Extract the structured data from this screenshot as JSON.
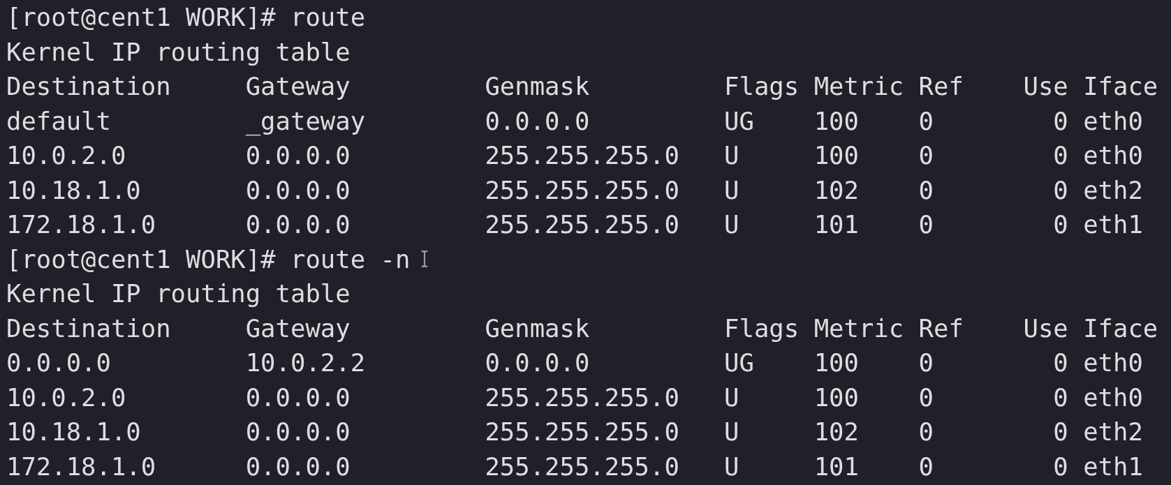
{
  "blocks": [
    {
      "prompt": "[root@cent1 WORK]#",
      "command": "route",
      "cursor": false,
      "title": "Kernel IP routing table",
      "columns": [
        "Destination",
        "Gateway",
        "Genmask",
        "Flags",
        "Metric",
        "Ref",
        "Use",
        "Iface"
      ],
      "rows": [
        [
          "default",
          "_gateway",
          "0.0.0.0",
          "UG",
          "100",
          "0",
          "0",
          "eth0"
        ],
        [
          "10.0.2.0",
          "0.0.0.0",
          "255.255.255.0",
          "U",
          "100",
          "0",
          "0",
          "eth0"
        ],
        [
          "10.18.1.0",
          "0.0.0.0",
          "255.255.255.0",
          "U",
          "102",
          "0",
          "0",
          "eth2"
        ],
        [
          "172.18.1.0",
          "0.0.0.0",
          "255.255.255.0",
          "U",
          "101",
          "0",
          "0",
          "eth1"
        ]
      ]
    },
    {
      "prompt": "[root@cent1 WORK]#",
      "command": "route -n",
      "cursor": true,
      "title": "Kernel IP routing table",
      "columns": [
        "Destination",
        "Gateway",
        "Genmask",
        "Flags",
        "Metric",
        "Ref",
        "Use",
        "Iface"
      ],
      "rows": [
        [
          "0.0.0.0",
          "10.0.2.2",
          "0.0.0.0",
          "UG",
          "100",
          "0",
          "0",
          "eth0"
        ],
        [
          "10.0.2.0",
          "0.0.0.0",
          "255.255.255.0",
          "U",
          "100",
          "0",
          "0",
          "eth0"
        ],
        [
          "10.18.1.0",
          "0.0.0.0",
          "255.255.255.0",
          "U",
          "102",
          "0",
          "0",
          "eth2"
        ],
        [
          "172.18.1.0",
          "0.0.0.0",
          "255.255.255.0",
          "U",
          "101",
          "0",
          "0",
          "eth1"
        ]
      ]
    }
  ]
}
